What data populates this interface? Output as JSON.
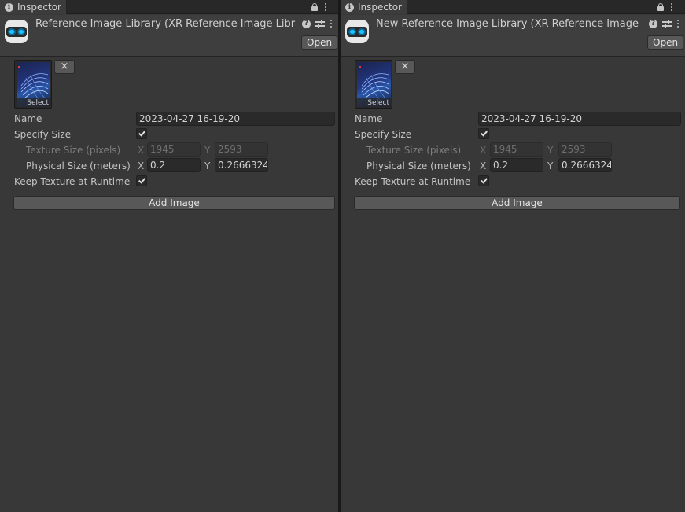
{
  "panels": [
    {
      "tab_label": "Inspector",
      "title": "Reference Image Library (XR Reference Image Library)",
      "open_label": "Open",
      "remove_label": "×",
      "thumbnail_select_label": "Select",
      "name_label": "Name",
      "name_value": "2023-04-27 16-19-20",
      "specify_size_label": "Specify Size",
      "specify_size_checked": true,
      "texture_size_label": "Texture Size (pixels)",
      "texture_x": "1945",
      "texture_y": "2593",
      "physical_size_label": "Physical Size (meters)",
      "physical_x": "0.2",
      "physical_y": "0.2666324",
      "keep_texture_label": "Keep Texture at Runtime",
      "keep_texture_checked": true,
      "add_image_label": "Add Image",
      "axis_x": "X",
      "axis_y": "Y"
    },
    {
      "tab_label": "Inspector",
      "title": "New Reference Image Library (XR Reference Image Library)",
      "open_label": "Open",
      "remove_label": "×",
      "thumbnail_select_label": "Select",
      "name_label": "Name",
      "name_value": "2023-04-27 16-19-20",
      "specify_size_label": "Specify Size",
      "specify_size_checked": true,
      "texture_size_label": "Texture Size (pixels)",
      "texture_x": "1945",
      "texture_y": "2593",
      "physical_size_label": "Physical Size (meters)",
      "physical_x": "0.2",
      "physical_y": "0.2666324",
      "keep_texture_label": "Keep Texture at Runtime",
      "keep_texture_checked": true,
      "add_image_label": "Add Image",
      "axis_x": "X",
      "axis_y": "Y"
    }
  ],
  "icons": {
    "tab": "info-icon",
    "lock": "lock-icon",
    "menu": "kebab-menu-icon",
    "help": "help-icon",
    "preset": "settings-sliders-icon",
    "asset": "xr-headset-icon"
  },
  "colors": {
    "panel_bg": "#383838",
    "field_bg": "#2a2a2a",
    "button_bg": "#585858",
    "text": "#c4c4c4"
  }
}
